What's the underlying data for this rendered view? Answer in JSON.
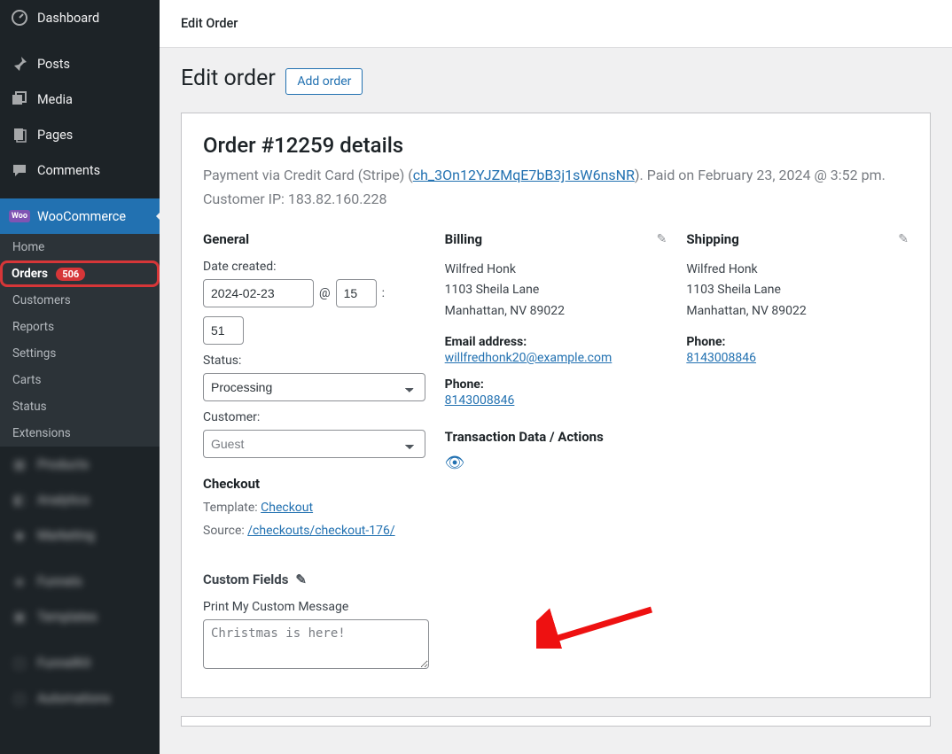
{
  "sidebar": {
    "dashboard": "Dashboard",
    "posts": "Posts",
    "media": "Media",
    "pages": "Pages",
    "comments": "Comments",
    "woocommerce": "WooCommerce",
    "sub": {
      "home": "Home",
      "orders": "Orders",
      "orders_badge": "506",
      "customers": "Customers",
      "reports": "Reports",
      "settings": "Settings",
      "carts": "Carts",
      "status": "Status",
      "extensions": "Extensions"
    }
  },
  "topbar": {
    "title": "Edit Order"
  },
  "page": {
    "title": "Edit order",
    "add_btn": "Add order"
  },
  "order": {
    "heading": "Order #12259 details",
    "sub_prefix": "Payment via Credit Card (Stripe) (",
    "txn_link": "ch_3On12YJZMqE7bB3j1sW6nsNR",
    "sub_suffix": "). Paid on February 23, 2024 @ 3:52 pm. Customer IP: 183.82.160.228"
  },
  "general": {
    "heading": "General",
    "date_lbl": "Date created:",
    "date": "2024-02-23",
    "at": "@",
    "hour": "15",
    "colon": ":",
    "min": "51",
    "status_lbl": "Status:",
    "status": "Processing",
    "customer_lbl": "Customer:",
    "customer": "Guest",
    "checkout_h": "Checkout",
    "template_k": "Template: ",
    "template_v": "Checkout",
    "source_k": "Source: ",
    "source_v": "/checkouts/checkout-176/"
  },
  "billing": {
    "heading": "Billing",
    "name": "Wilfred Honk",
    "addr1": "1103 Sheila Lane",
    "addr2": "Manhattan, NV 89022",
    "email_h": "Email address:",
    "email": "willfredhonk20@example.com",
    "phone_h": "Phone:",
    "phone": "8143008846",
    "txn_h": "Transaction Data / Actions"
  },
  "shipping": {
    "heading": "Shipping",
    "name": "Wilfred Honk",
    "addr1": "1103 Sheila Lane",
    "addr2": "Manhattan, NV 89022",
    "phone_h": "Phone:",
    "phone": "8143008846"
  },
  "custom": {
    "heading": "Custom Fields",
    "field_lbl": "Print My Custom Message",
    "field_val": "Christmas is here!"
  }
}
